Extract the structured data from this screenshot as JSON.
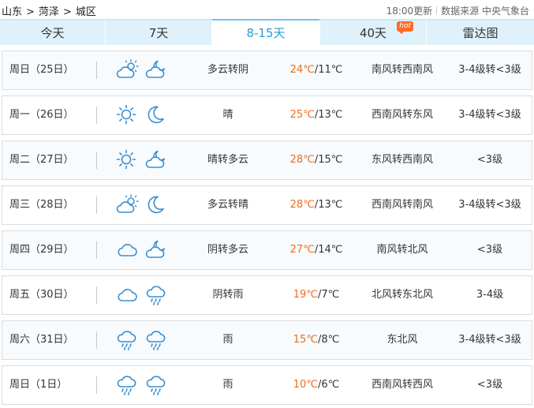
{
  "breadcrumb": [
    "山东",
    "菏泽",
    "城区"
  ],
  "breadcrumb_sep": ">",
  "header": {
    "updated": "18:00更新",
    "source": "数据来源 中央气象台"
  },
  "tabs": [
    {
      "label": "今天",
      "active": false
    },
    {
      "label": "7天",
      "active": false
    },
    {
      "label": "8-15天",
      "active": true
    },
    {
      "label": "40天",
      "active": false,
      "badge": "hot"
    },
    {
      "label": "雷达图",
      "active": false
    }
  ],
  "colors": {
    "accent": "#2a9ad6",
    "high_temp": "#f06b1d",
    "tab_bg": "#dff1fb",
    "hot_badge": "#ff6a27",
    "icon": "#3a8fd2"
  },
  "forecast": [
    {
      "date": "周日（25日）",
      "day_icon": "partly-cloudy-sun-icon",
      "night_icon": "cloudy-moon-icon",
      "desc": "多云转阴",
      "high": "24℃",
      "low": "/11℃",
      "wind": "南风转西南风",
      "level": "3-4级转<3级"
    },
    {
      "date": "周一（26日）",
      "day_icon": "sun-icon",
      "night_icon": "moon-icon",
      "desc": "晴",
      "high": "25℃",
      "low": "/13℃",
      "wind": "西南风转东风",
      "level": "3-4级转<3级"
    },
    {
      "date": "周二（27日）",
      "day_icon": "sun-icon",
      "night_icon": "cloudy-moon-icon",
      "desc": "晴转多云",
      "high": "28℃",
      "low": "/15℃",
      "wind": "东风转西南风",
      "level": "<3级"
    },
    {
      "date": "周三（28日）",
      "day_icon": "partly-cloudy-sun-icon",
      "night_icon": "moon-icon",
      "desc": "多云转晴",
      "high": "28℃",
      "low": "/13℃",
      "wind": "西南风转南风",
      "level": "3-4级转<3级"
    },
    {
      "date": "周四（29日）",
      "day_icon": "cloud-icon",
      "night_icon": "cloudy-moon-icon",
      "desc": "阴转多云",
      "high": "27℃",
      "low": "/14℃",
      "wind": "南风转北风",
      "level": "<3级"
    },
    {
      "date": "周五（30日）",
      "day_icon": "cloud-icon",
      "night_icon": "rain-cloud-icon",
      "desc": "阴转雨",
      "high": "19℃",
      "low": "/7℃",
      "wind": "北风转东北风",
      "level": "3-4级"
    },
    {
      "date": "周六（31日）",
      "day_icon": "rain-cloud-icon",
      "night_icon": "rain-cloud-icon",
      "desc": "雨",
      "high": "15℃",
      "low": "/8℃",
      "wind": "东北风",
      "level": "3-4级转<3级"
    },
    {
      "date": "周日（1日）",
      "day_icon": "rain-cloud-icon",
      "night_icon": "rain-cloud-icon",
      "desc": "雨",
      "high": "10℃",
      "low": "/6℃",
      "wind": "西南风转西风",
      "level": "<3级"
    }
  ]
}
